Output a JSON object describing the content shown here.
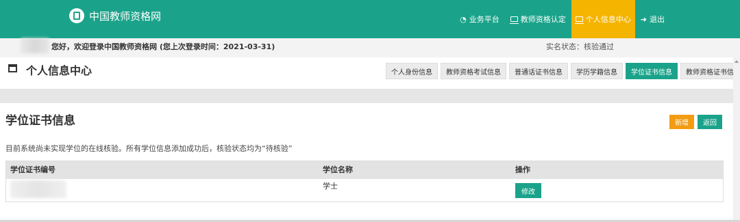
{
  "header": {
    "site_title": "中国教师资格网",
    "nav": [
      {
        "label": "业务平台",
        "icon": "dashboard-icon"
      },
      {
        "label": "教师资格认定",
        "icon": "monitor-icon"
      },
      {
        "label": "个人信息中心",
        "icon": "monitor-icon",
        "active": true
      },
      {
        "label": "退出",
        "icon": "logout-icon"
      }
    ]
  },
  "welcome": {
    "text": "您好，欢迎登录中国教师资格网 (您上次登录时间：2021-03-31)",
    "status": "实名状态：核验通过"
  },
  "panel": {
    "title": "个人信息中心",
    "tabs": [
      "个人身份信息",
      "教师资格考试信息",
      "普通话证书信息",
      "学历学籍信息",
      "学位证书信息",
      "教师资格证书信息"
    ],
    "active_tab": "学位证书信息"
  },
  "section": {
    "title": "学位证书信息",
    "add_label": "新增",
    "back_label": "返回",
    "note": "目前系统尚未实现学位的在线核验。所有学位信息添加成功后，核验状态均为“待核验”"
  },
  "table": {
    "headers": [
      "学位证书编号",
      "学位名称",
      "操作"
    ],
    "rows": [
      {
        "degree_name": "学士",
        "action": "修改"
      }
    ]
  },
  "colors": {
    "primary": "#1aa38a",
    "accent": "#f5b400",
    "add_button": "#f39c12"
  }
}
